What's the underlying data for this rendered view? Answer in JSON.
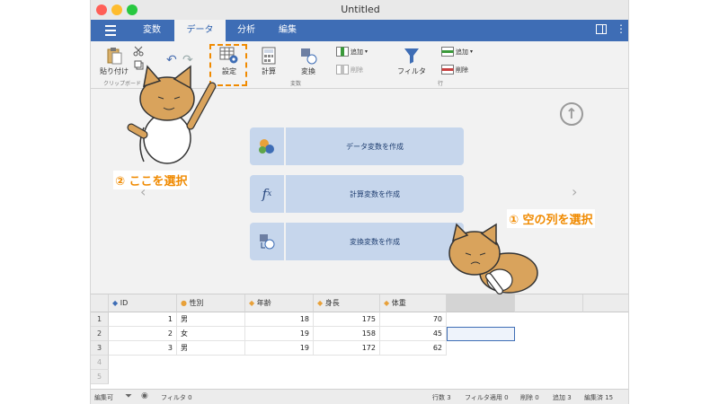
{
  "window": {
    "title": "Untitled"
  },
  "menu": {
    "tabs": [
      {
        "label": "変数"
      },
      {
        "label": "データ"
      },
      {
        "label": "分析"
      },
      {
        "label": "編集"
      }
    ]
  },
  "ribbon": {
    "paste": "貼り付け",
    "clipboard_group": "クリップボード",
    "setup": "設定",
    "compute": "計算",
    "transform": "変換",
    "add_var": "追加",
    "delete_var": "削除",
    "variables_group": "変数",
    "filter": "フィルタ",
    "add_row": "追加",
    "delete_row": "削除",
    "rows_group": "行"
  },
  "wizard": {
    "data_var": "データ変数を作成",
    "computed_var": "計算変数を作成",
    "transformed_var": "変換変数を作成"
  },
  "callouts": {
    "select_here": "② ここを選択",
    "select_empty": "① 空の列を選択"
  },
  "grid": {
    "headers": [
      {
        "label": "ID"
      },
      {
        "label": "性別"
      },
      {
        "label": "年齢"
      },
      {
        "label": "身長"
      },
      {
        "label": "体重"
      }
    ],
    "row_numbers": [
      "1",
      "2",
      "3",
      "4",
      "5"
    ],
    "rows": [
      [
        "1",
        "男",
        "18",
        "175",
        "70"
      ],
      [
        "2",
        "女",
        "19",
        "158",
        "45"
      ],
      [
        "3",
        "男",
        "19",
        "172",
        "62"
      ]
    ]
  },
  "status": {
    "mode": "編集可",
    "filter": "フィルタ 0",
    "row_count": "行数 3",
    "filtered": "フィルタ適用 0",
    "deleted": "削除 0",
    "added": "追加 3",
    "edited": "編集済 15"
  },
  "colors": {
    "accent": "#3e6db5",
    "callout": "#f08a00"
  }
}
